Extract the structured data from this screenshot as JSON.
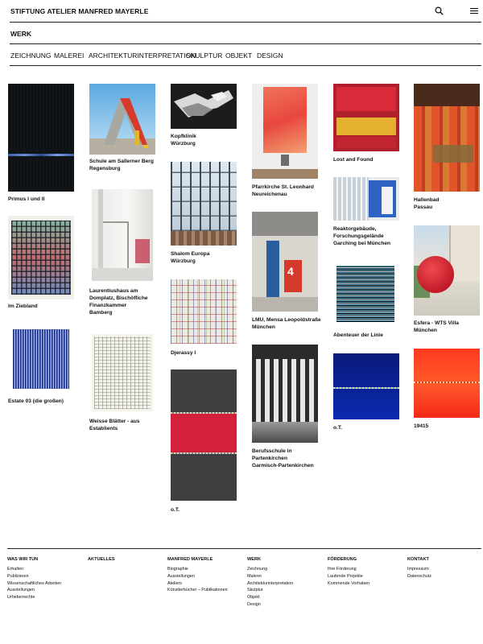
{
  "header": {
    "site_title": "STIFTUNG ATELIER MANFRED MAYERLE"
  },
  "section": {
    "title": "WERK"
  },
  "categories": [
    "ZEICHNUNG",
    "MALEREI",
    "ARCHITEKTURINTERPRETATION",
    "SKULPTUR",
    "OBJEKT",
    "DESIGN"
  ],
  "works": {
    "primus": "Primus I und II",
    "ziebland": "Im Ziebland",
    "estate": "Estate 03 (die großen)",
    "schule": "Schule am Sallerner Berg\nRegensburg",
    "laurentius": "Laurentiushaus am\nDomplatz, Bischöfliche\nFinanzkammer\nBamberg",
    "weisse": "Weisse Blätter - aus\nEstablients",
    "kopfklinik": "Kopfklinik\nWürzburg",
    "shalom": "Shalom Europa\nWürzburg",
    "djerassy": "Djerassy I",
    "ot_red": "o.T.",
    "pfarrkirche": "Pfarrkirche St. Leonhard\nNeureichenau",
    "lmu": "LMU, Mensa Leopoldstraße\nMünchen",
    "berufsschule": "Berufsschule in\nPartenkirchen\nGarmisch-Partenkirchen",
    "lost": "Lost and Found",
    "reaktor": "Reaktorgebäude,\nForschungsgelände\nGarching bei München",
    "abenteuer": "Abenteuer der Linie",
    "ot_blue": "o.T.",
    "hallenbad": "Hallenbad\nPassau",
    "esfera": "Esfera - WTS Villa\nMünchen",
    "n19415": "19415"
  },
  "footer": {
    "was": {
      "heading": "WAS WIR TUN",
      "links": [
        "Erhalten",
        "Publizieren",
        "Wissenschaftliches Arbeiten",
        "Ausstellungen",
        "Urheberrechte"
      ]
    },
    "aktuelles": {
      "heading": "AKTUELLES"
    },
    "mayerle": {
      "heading": "MANFRED MAYERLE",
      "links": [
        "Biographie",
        "Ausstellungen",
        "Ateliers",
        "Künstlerbücher – Publikationen"
      ]
    },
    "werk": {
      "heading": "WERK",
      "links": [
        "Zeichnung",
        "Malerei",
        "Architekturinterpretation",
        "Skulptur",
        "Objekt",
        "Design"
      ]
    },
    "foerderung": {
      "heading": "FÖRDERUNG",
      "links": [
        "Ihre Förderung",
        "Laufende Projekte",
        "Kommende Vorhaben"
      ]
    },
    "kontakt": {
      "heading": "KONTAKT",
      "links": [
        "Impressum",
        "Datenschutz"
      ]
    }
  },
  "icons": {
    "search": "search-icon",
    "menu": "hamburger-menu-icon"
  }
}
